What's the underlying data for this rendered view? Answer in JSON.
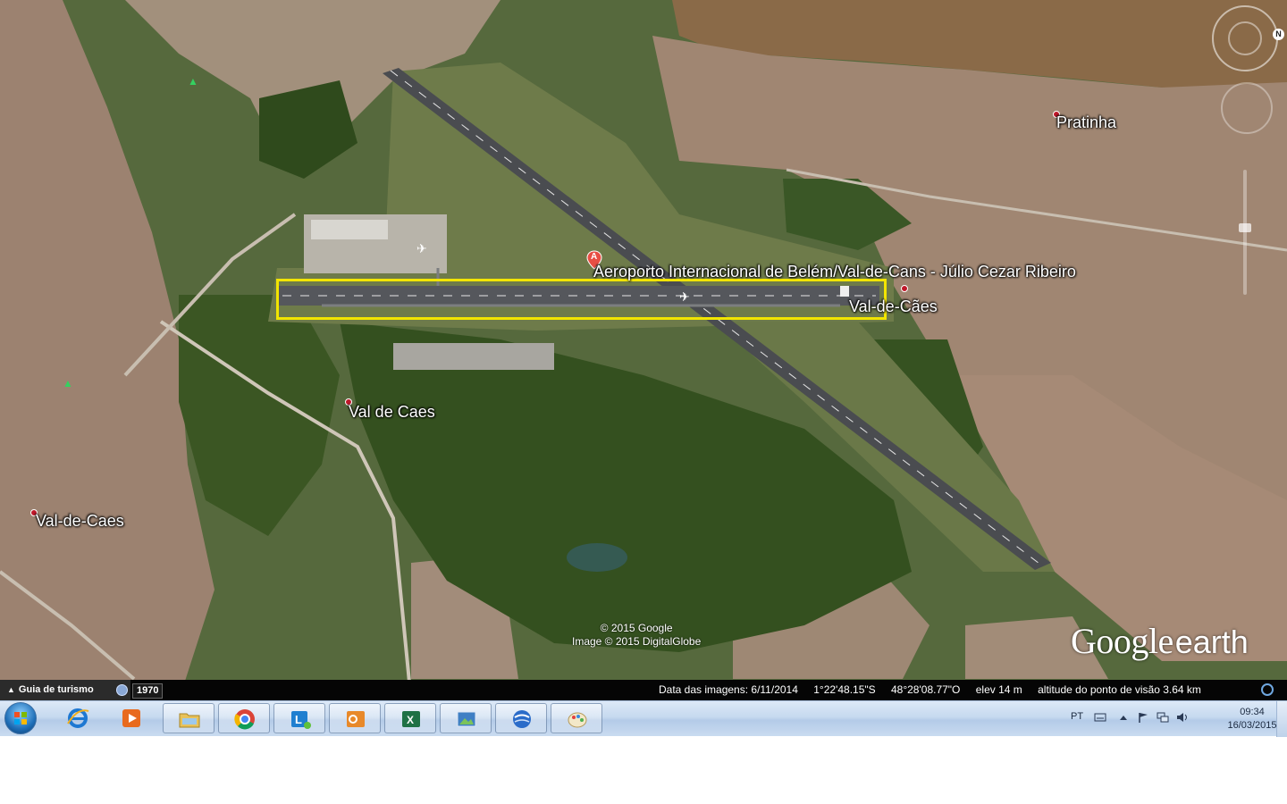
{
  "map": {
    "places": {
      "airport": "Aeroporto Internacional de Belém/Val-de-Cans - Júlio Cezar Ribeiro",
      "val_de_caes_center": "Val de Caes",
      "val_de_caes_east": "Val-de-Cães",
      "val_de_caes_west": "Val-de-Caes",
      "pratinha": "Pratinha"
    },
    "placemark_letter": "A",
    "highlight_color": "#f2e500",
    "copyright_lines": [
      "© 2015 Google",
      "Image © 2015 DigitalGlobe"
    ],
    "logo": {
      "word1": "Google",
      "word2": "earth"
    },
    "north_label": "N"
  },
  "status_bar": {
    "tour_guide": "Guia de turismo",
    "historical_year": "1970",
    "imagery_date": "Data das imagens: 6/11/2014",
    "latitude": "1°22'48.15\"S",
    "longitude": "48°28'08.77\"O",
    "elevation": "elev   14 m",
    "eye_altitude": "altitude do ponto de visão   3.64 km"
  },
  "taskbar": {
    "apps": [
      {
        "id": "ie",
        "icon": "internet-explorer-icon"
      },
      {
        "id": "media",
        "icon": "media-player-icon"
      },
      {
        "id": "explorer",
        "icon": "folder-icon"
      },
      {
        "id": "chrome",
        "icon": "chrome-icon"
      },
      {
        "id": "lync",
        "icon": "lync-icon"
      },
      {
        "id": "outlook",
        "icon": "outlook-icon"
      },
      {
        "id": "excel",
        "icon": "excel-icon"
      },
      {
        "id": "photos",
        "icon": "photo-viewer-icon"
      },
      {
        "id": "google-earth",
        "icon": "google-earth-icon"
      },
      {
        "id": "paint",
        "icon": "paint-icon"
      }
    ],
    "language": "PT",
    "time": "09:34",
    "date": "16/03/2015"
  }
}
